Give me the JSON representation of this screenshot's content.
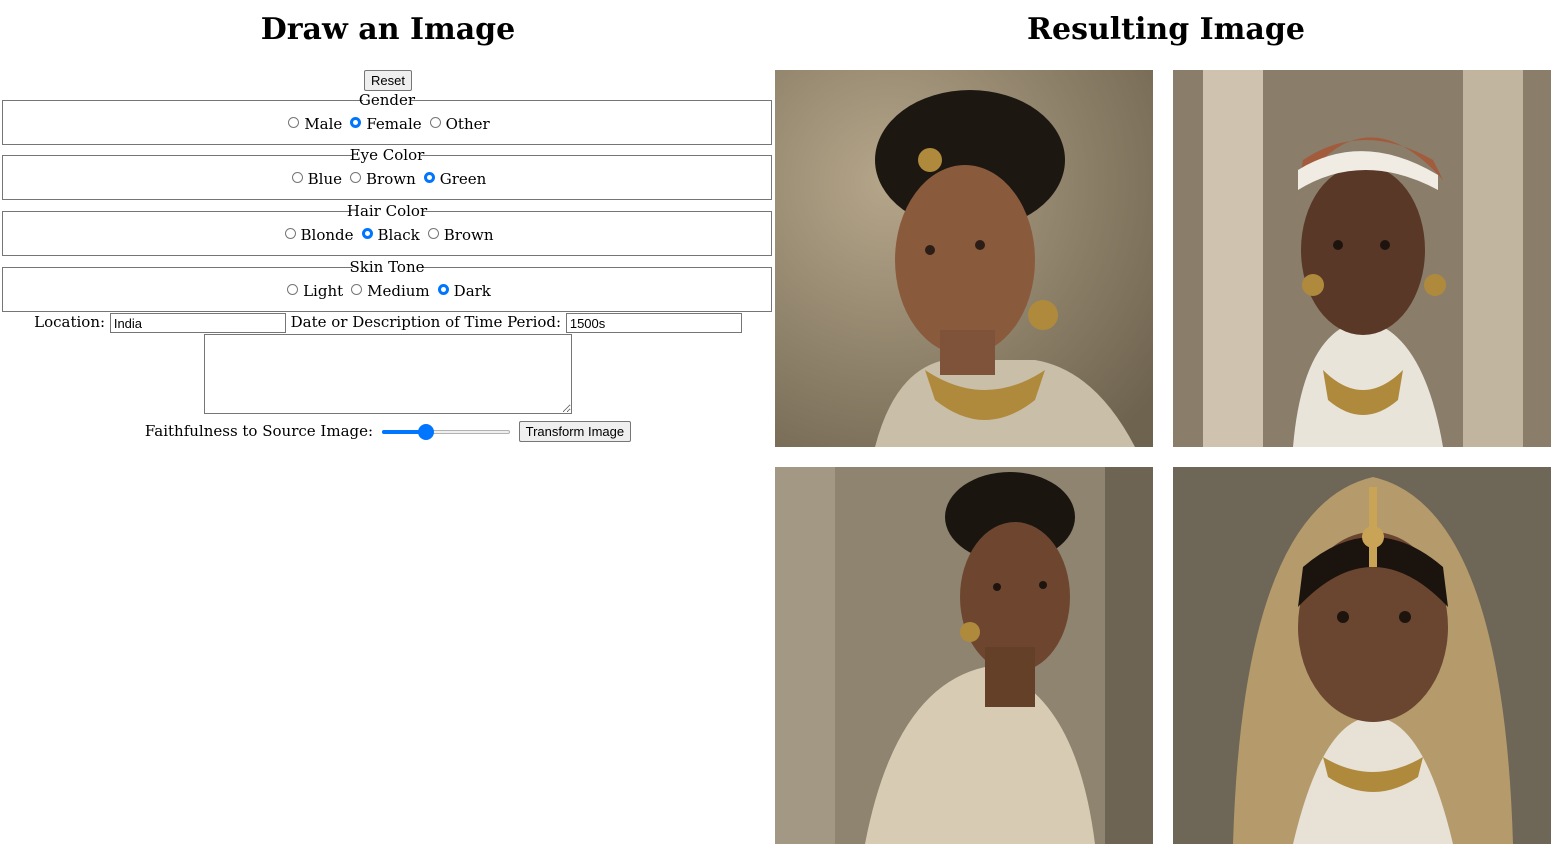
{
  "left_title": "Draw an Image",
  "right_title": "Resulting Image",
  "reset_label": "Reset",
  "fieldsets": [
    {
      "legend": "Gender",
      "options": [
        "Male",
        "Female",
        "Other"
      ],
      "selected": "Female"
    },
    {
      "legend": "Eye Color",
      "options": [
        "Blue",
        "Brown",
        "Green"
      ],
      "selected": "Green"
    },
    {
      "legend": "Hair Color",
      "options": [
        "Blonde",
        "Black",
        "Brown"
      ],
      "selected": "Black"
    },
    {
      "legend": "Skin Tone",
      "options": [
        "Light",
        "Medium",
        "Dark"
      ],
      "selected": "Dark"
    }
  ],
  "location": {
    "label": "Location:",
    "value": "India"
  },
  "period": {
    "label": "Date or Description of Time Period:",
    "value": "1500s"
  },
  "description": {
    "value": ""
  },
  "faithfulness": {
    "label": "Faithfulness to Source Image:",
    "value": 0.32
  },
  "transform_label": "Transform Image",
  "colors": {
    "accent": "#0075ff"
  }
}
